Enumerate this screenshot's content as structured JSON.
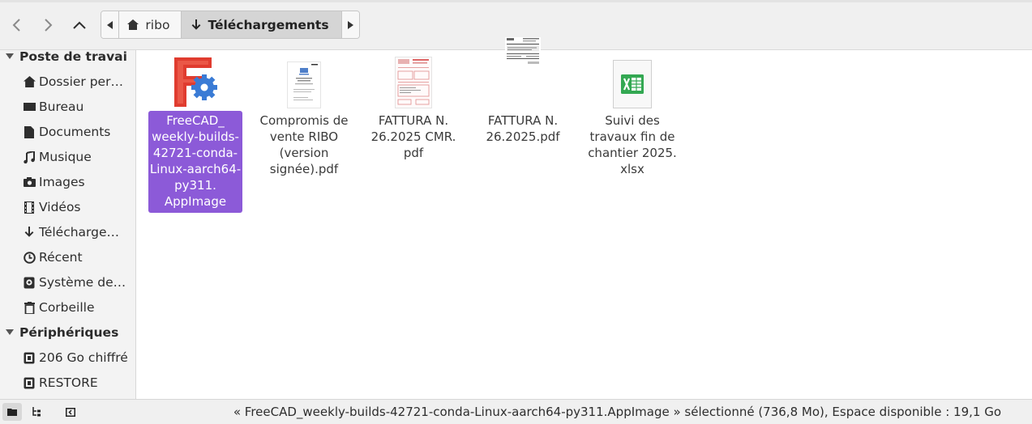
{
  "window": {
    "title": "Téléchargements"
  },
  "navigation": {
    "back_icon": "back-arrow-icon",
    "forward_icon": "forward-arrow-icon",
    "up_icon": "up-arrow-icon"
  },
  "path_bar": {
    "crumbs": [
      {
        "label": "ribo",
        "icon": "home-icon"
      },
      {
        "label": "Téléchargements",
        "icon": "download-arrow-icon",
        "active": true
      }
    ]
  },
  "sidebar": {
    "sections": [
      {
        "label": "Poste de travai",
        "items": [
          {
            "label": "Dossier personnel",
            "icon": "home-icon"
          },
          {
            "label": "Bureau",
            "icon": "desktop-icon"
          },
          {
            "label": "Documents",
            "icon": "document-icon"
          },
          {
            "label": "Musique",
            "icon": "music-icon"
          },
          {
            "label": "Images",
            "icon": "camera-icon"
          },
          {
            "label": "Vidéos",
            "icon": "film-icon"
          },
          {
            "label": "Téléchargements",
            "icon": "download-arrow-icon"
          },
          {
            "label": "Récent",
            "icon": "clock-icon"
          },
          {
            "label": "Système de fichiers",
            "icon": "drive-icon"
          },
          {
            "label": "Corbeille",
            "icon": "trash-icon"
          }
        ]
      },
      {
        "label": "Périphériques",
        "items": [
          {
            "label": "206 Go chiffré",
            "icon": "disk-icon"
          },
          {
            "label": "RESTORE",
            "icon": "disk-icon"
          }
        ]
      }
    ]
  },
  "files": [
    {
      "name": "FreeCAD_ weekly-builds-42721-conda-Linux-aarch64-py311. AppImage",
      "icon": "freecad-logo-icon",
      "selected": true
    },
    {
      "name": "Compromis de vente RIBO (version signée).pdf",
      "icon": "pdf-thumbnail-icon"
    },
    {
      "name": "FATTURA N. 26.2025 CMR. pdf",
      "icon": "pdf-invoice-thumbnail-icon"
    },
    {
      "name": "FATTURA N. 26.2025.pdf",
      "icon": "pdf-invoice-thumbnail-icon"
    },
    {
      "name": "Suivi des travaux fin de chantier 2025. xlsx",
      "icon": "spreadsheet-icon"
    }
  ],
  "status_bar": {
    "text": "« FreeCAD_weekly-builds-42721-conda-Linux-aarch64-py311.AppImage » sélectionné (736,8 Mo), Espace disponible : 19,1 Go"
  },
  "colors": {
    "selection": "#8c5ad8",
    "freecad_red": "#e03c2f",
    "freecad_blue": "#3a7bd5",
    "spreadsheet_green": "#33a852"
  }
}
